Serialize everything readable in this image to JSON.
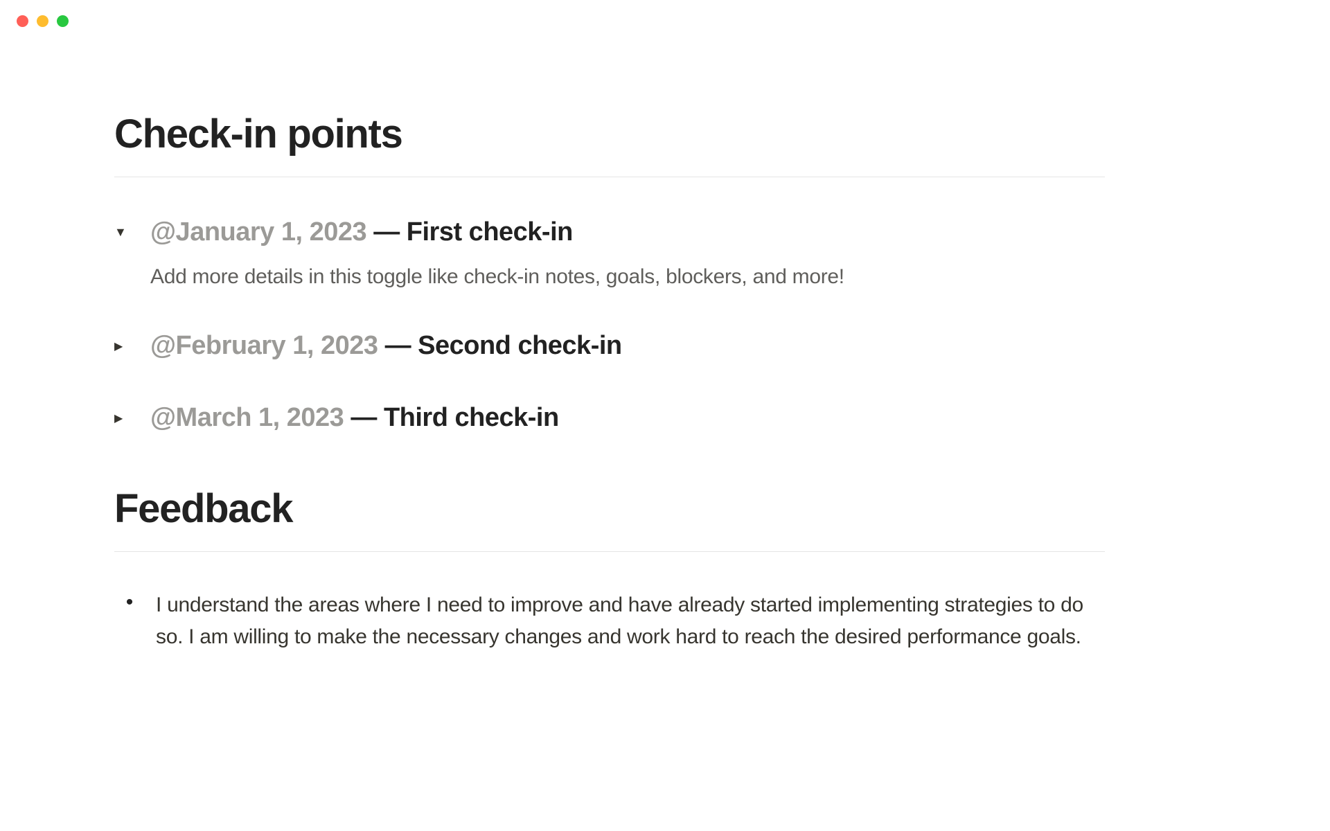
{
  "sections": {
    "checkin": {
      "heading": "Check-in points",
      "items": [
        {
          "date": "@January 1, 2023",
          "separator": " — ",
          "title": "First check-in",
          "expanded": true,
          "body": "Add more details in this toggle like check-in notes, goals, blockers, and more!"
        },
        {
          "date": "@February 1, 2023",
          "separator": " — ",
          "title": "Second check-in",
          "expanded": false
        },
        {
          "date": "@March 1, 2023",
          "separator": " — ",
          "title": "Third check-in",
          "expanded": false
        }
      ]
    },
    "feedback": {
      "heading": "Feedback",
      "bullets": [
        "I understand the areas where I need to improve and have already started implementing strategies to do so. I am willing to make the necessary changes and work hard to reach the desired performance goals."
      ]
    }
  }
}
